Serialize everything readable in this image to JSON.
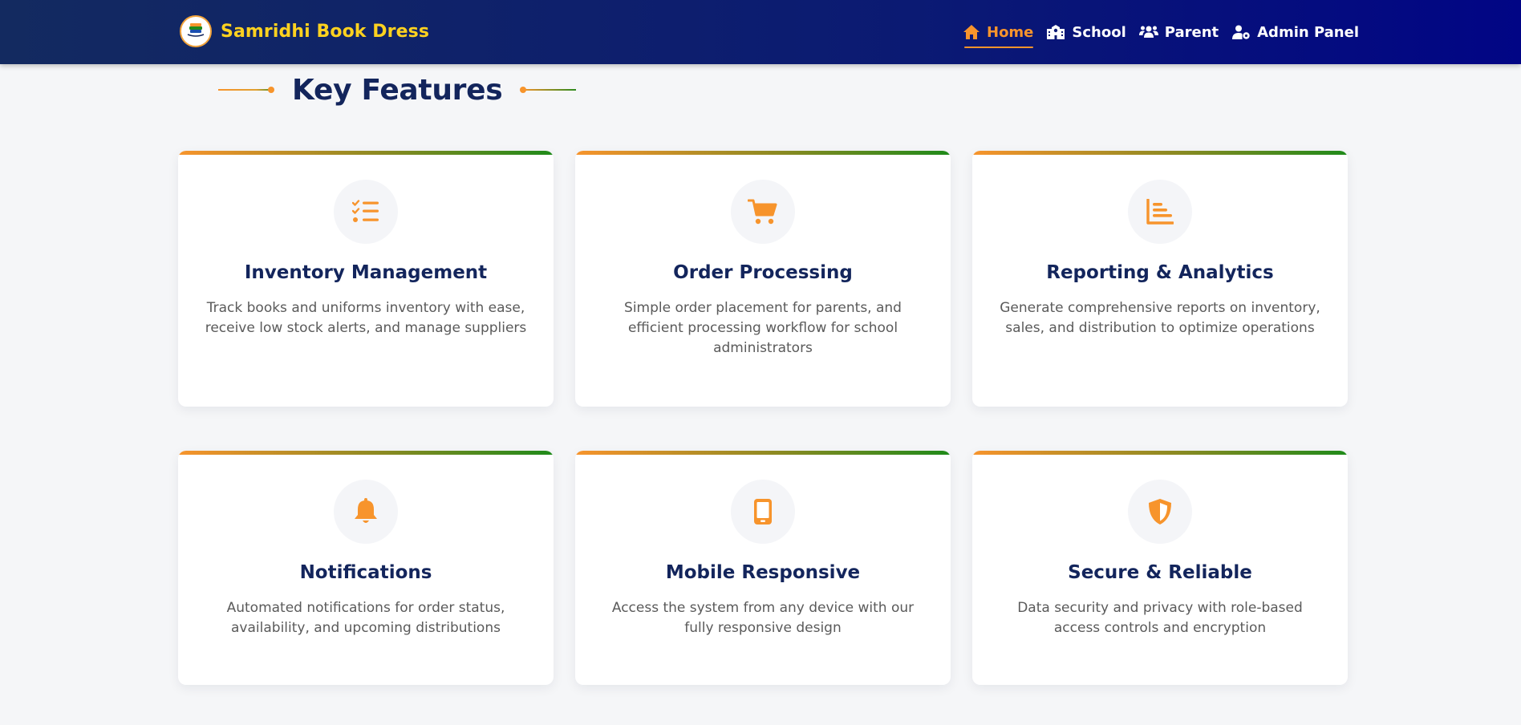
{
  "navbar": {
    "brand_name": "Samridhi Book Dress",
    "logo_text": "SAMRIDHI",
    "links": [
      {
        "label": "Home",
        "icon": "home-icon",
        "active": true
      },
      {
        "label": "School",
        "icon": "school-icon",
        "active": false
      },
      {
        "label": "Parent",
        "icon": "users-icon",
        "active": false
      },
      {
        "label": "Admin Panel",
        "icon": "user-gear-icon",
        "active": false
      }
    ]
  },
  "section": {
    "title": "Key Features"
  },
  "features": [
    {
      "title": "Inventory Management",
      "description": "Track books and uniforms inventory with ease, receive low stock alerts, and manage suppliers",
      "icon": "checklist-icon"
    },
    {
      "title": "Order Processing",
      "description": "Simple order placement for parents, and efficient processing workflow for school administrators",
      "icon": "shopping-cart-icon"
    },
    {
      "title": "Reporting & Analytics",
      "description": "Generate comprehensive reports on inventory, sales, and distribution to optimize operations",
      "icon": "bar-chart-icon"
    },
    {
      "title": "Notifications",
      "description": "Automated notifications for order status, availability, and upcoming distributions",
      "icon": "bell-icon"
    },
    {
      "title": "Mobile Responsive",
      "description": "Access the system from any device with our fully responsive design",
      "icon": "mobile-icon"
    },
    {
      "title": "Secure & Reliable",
      "description": "Data security and privacy with role-based access controls and encryption",
      "icon": "shield-icon"
    }
  ],
  "colors": {
    "accent": "#f7942c",
    "navy": "#13255c",
    "brand_yellow": "#ffd21f",
    "green": "#1f8a1a"
  }
}
